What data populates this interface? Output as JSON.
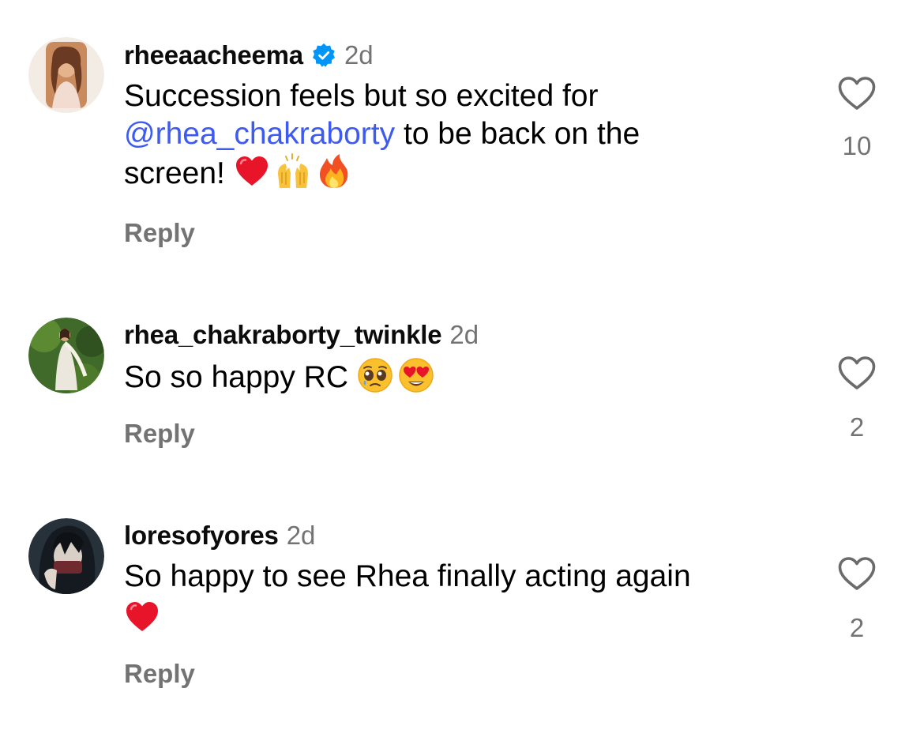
{
  "colors": {
    "mention": "#3d5af1",
    "meta": "#737373",
    "verified": "#0095f6",
    "heart_emoji": "#e8142a"
  },
  "comments": [
    {
      "username": "rheeaacheema",
      "verified": true,
      "time": "2d",
      "text_before": "Succession feels but so excited for",
      "mention": "@rhea_chakraborty",
      "text_after": " to be back on the",
      "text_line3": "screen! ",
      "emojis": [
        "red-heart",
        "raised-hands",
        "fire"
      ],
      "reply_label": "Reply",
      "likes": "10"
    },
    {
      "username": "rhea_chakraborty_twinkle",
      "verified": false,
      "time": "2d",
      "text": "So so happy RC ",
      "emojis": [
        "pleading-face",
        "heart-eyes"
      ],
      "reply_label": "Reply",
      "likes": "2"
    },
    {
      "username": "loresofyores",
      "verified": false,
      "time": "2d",
      "text": "So happy to see Rhea finally acting again",
      "emojis": [
        "red-heart"
      ],
      "reply_label": "Reply",
      "likes": "2"
    }
  ]
}
